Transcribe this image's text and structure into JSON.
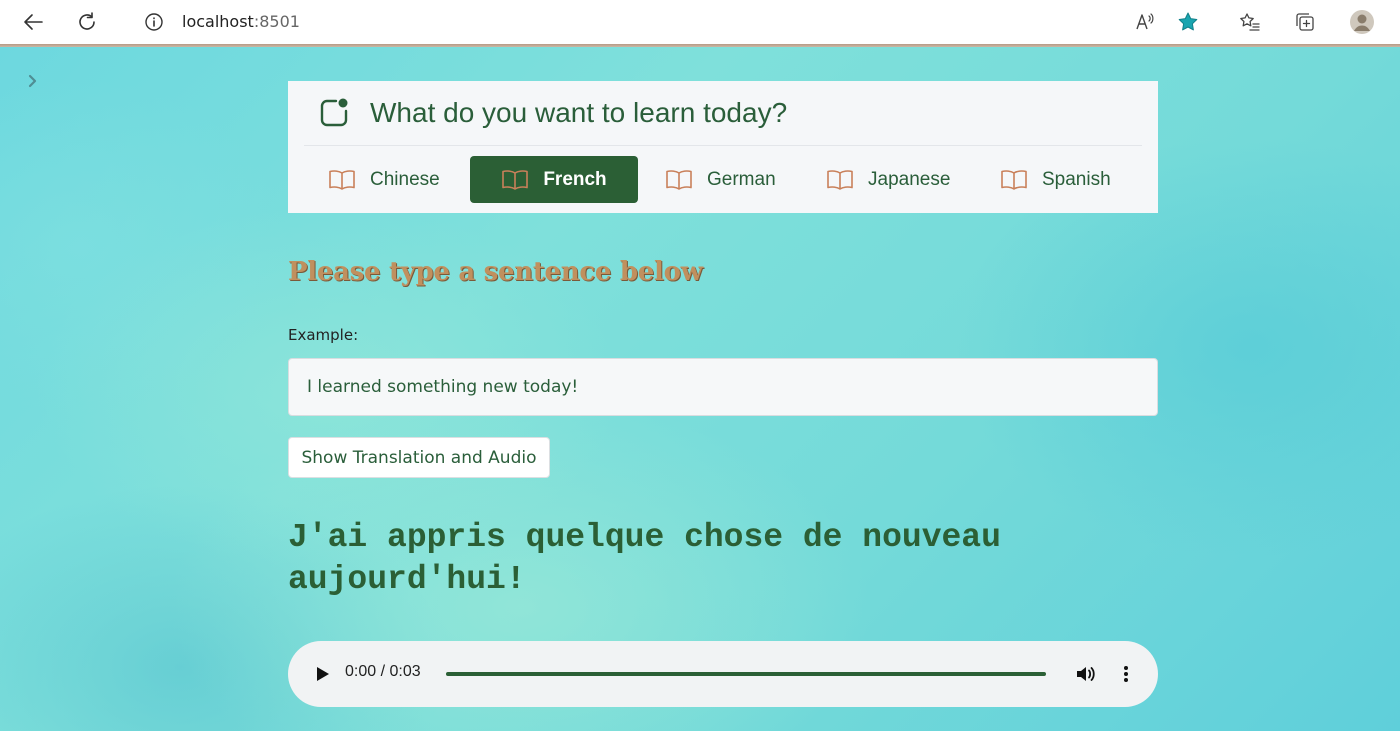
{
  "browser": {
    "url_host": "localhost",
    "url_port": ":8501",
    "accent_color": "#1aa5b0"
  },
  "menu": {
    "title": "What do you want to learn today?",
    "tabs": [
      {
        "label": "Chinese",
        "active": false
      },
      {
        "label": "French",
        "active": true
      },
      {
        "label": "German",
        "active": false
      },
      {
        "label": "Japanese",
        "active": false
      },
      {
        "label": "Spanish",
        "active": false
      }
    ],
    "active_color": "#2b5f35",
    "icon_color": "#c9805a"
  },
  "main": {
    "heading": "Please type a sentence below",
    "example_label": "Example:",
    "input_value": "I learned something new today!",
    "button_label": "Show Translation and Audio",
    "translation": "J'ai appris quelque chose de nouveau aujourd'hui!"
  },
  "audio": {
    "time": "0:00 / 0:03",
    "progress": 0
  }
}
